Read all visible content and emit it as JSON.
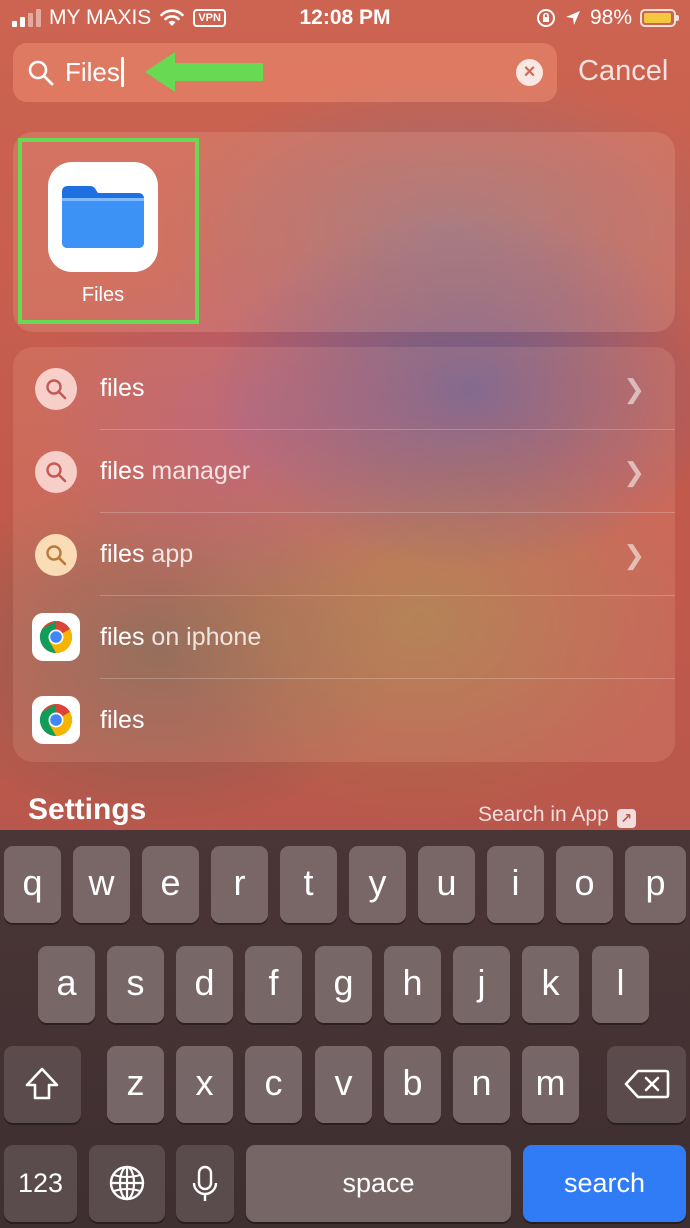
{
  "status_bar": {
    "carrier": "MY MAXIS",
    "vpn": "VPN",
    "time": "12:08 PM",
    "battery": "98%"
  },
  "search": {
    "query": "Files",
    "cancel_label": "Cancel"
  },
  "top_hit": {
    "app_name": "Files"
  },
  "suggestions": [
    {
      "bold": "files",
      "rest": "",
      "icon": "search",
      "chevron": true
    },
    {
      "bold": "files",
      "rest": " manager",
      "icon": "search",
      "chevron": true
    },
    {
      "bold": "files",
      "rest": " app",
      "icon": "search",
      "chevron": true
    },
    {
      "bold": "files",
      "rest": " on iphone",
      "icon": "chrome",
      "chevron": false
    },
    {
      "bold": "files",
      "rest": "",
      "icon": "chrome",
      "chevron": false
    }
  ],
  "settings": {
    "title": "Settings",
    "search_in_app": "Search in App"
  },
  "keyboard": {
    "row1": [
      "q",
      "w",
      "e",
      "r",
      "t",
      "y",
      "u",
      "i",
      "o",
      "p"
    ],
    "row2": [
      "a",
      "s",
      "d",
      "f",
      "g",
      "h",
      "j",
      "k",
      "l"
    ],
    "row3": [
      "z",
      "x",
      "c",
      "v",
      "b",
      "n",
      "m"
    ],
    "numbers_label": "123",
    "space_label": "space",
    "return_label": "search"
  },
  "colors": {
    "highlight": "#68d952",
    "accent_blue": "#2f7cf6",
    "battery": "#f3c73f"
  }
}
